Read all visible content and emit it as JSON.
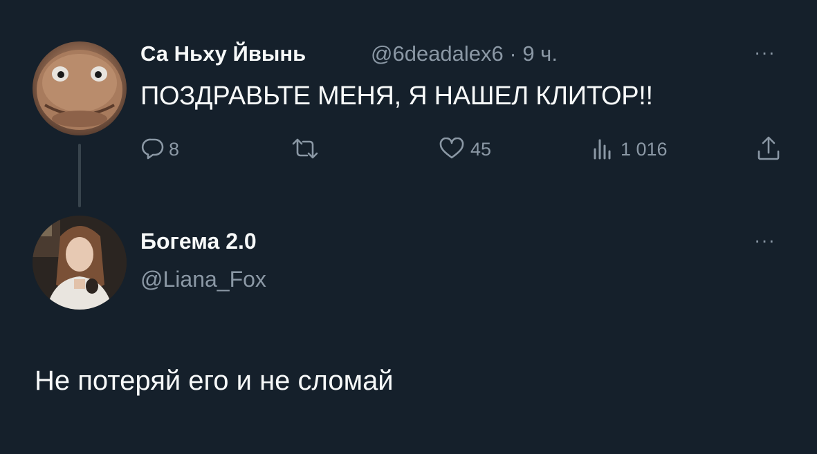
{
  "tweet": {
    "author_name": "Са Ньху Йвынь",
    "author_handle": "@6deadalex6 · 9 ч.",
    "more_icon": "···",
    "text": "ПОЗДРАВЬТЕ МЕНЯ, Я НАШЕЛ КЛИТОР!!",
    "actions": {
      "reply_count": "8",
      "retweet_count": "",
      "like_count": "45",
      "views_count": "1 016"
    }
  },
  "reply": {
    "author_name": "Богема 2.0",
    "author_handle": "@Liana_Fox",
    "more_icon": "···",
    "text": "Не потеряй его и не сломай"
  },
  "colors": {
    "background": "#15202b",
    "primary_text": "#f7f9f9",
    "secondary_text": "#8b98a5",
    "thread_line": "#38444d"
  },
  "icons": [
    "reply-icon",
    "retweet-icon",
    "like-icon",
    "views-icon",
    "share-icon",
    "more-icon"
  ]
}
